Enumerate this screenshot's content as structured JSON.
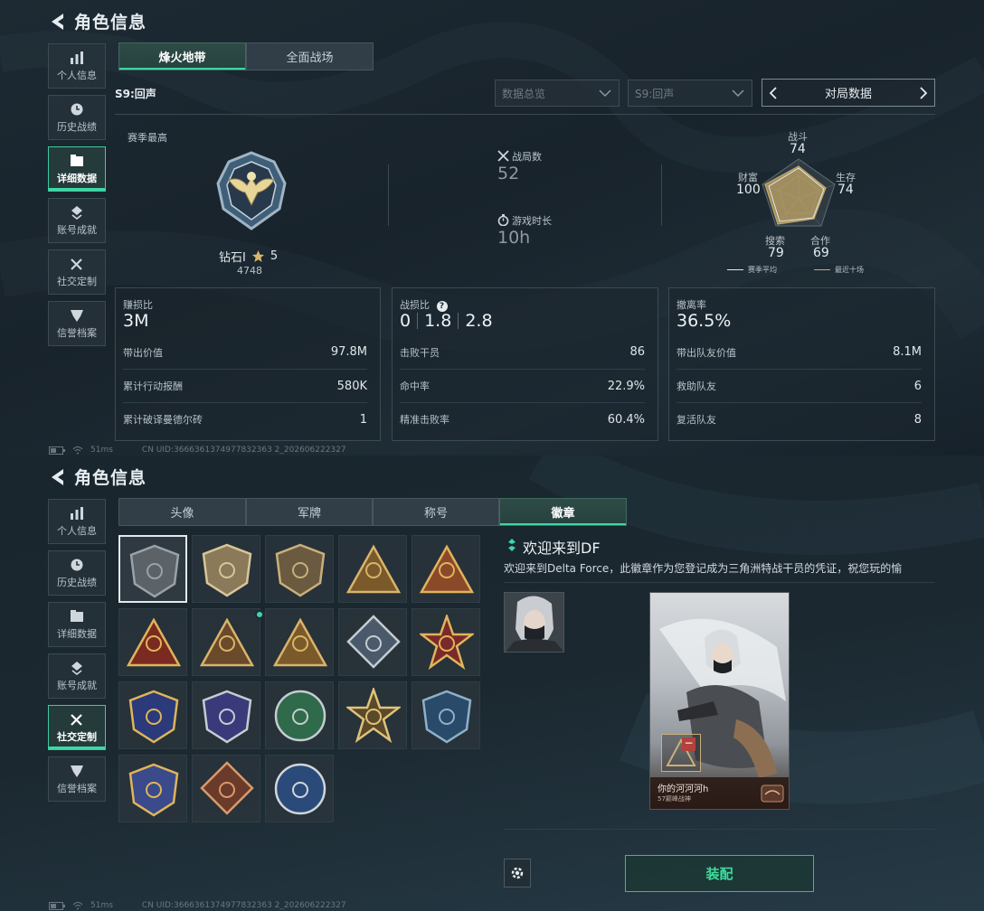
{
  "page_title": "角色信息",
  "sidebar": {
    "items": [
      {
        "label": "个人信息",
        "icon": "bar-chart-icon"
      },
      {
        "label": "历史战绩",
        "icon": "clock-icon"
      },
      {
        "label": "详细数据",
        "icon": "folder-icon"
      },
      {
        "label": "账号成就",
        "icon": "achievement-icon"
      },
      {
        "label": "社交定制",
        "icon": "tools-icon"
      },
      {
        "label": "信誉档案",
        "icon": "shield-icon"
      }
    ]
  },
  "screen1": {
    "tabs": [
      "烽火地带",
      "全面战场"
    ],
    "season": "S9:回声",
    "filter1": "数据总览",
    "filter2": "S9:回声",
    "pager_label": "对局数据",
    "season_best_label": "赛季最高",
    "rank_name": "钻石I",
    "rank_stars": "5",
    "rank_points": "4748",
    "matches_label": "战局数",
    "matches_value": "52",
    "playtime_label": "游戏时长",
    "playtime_value": "10h",
    "radar": {
      "labels": {
        "top": "战斗",
        "top_val": "74",
        "left": "财富",
        "left_val": "100",
        "right": "生存",
        "right_val": "74",
        "bl": "搜索",
        "bl_val": "79",
        "br": "合作",
        "br_val": "69"
      },
      "legend_avg": "赛季平均",
      "legend_recent": "最近十场",
      "colors": {
        "avg": "#e6e6e6",
        "recent": "#c7aa6a"
      }
    },
    "cards": [
      {
        "title": "赚损比",
        "value": "3M",
        "rows": [
          {
            "label": "带出价值",
            "value": "97.8M"
          },
          {
            "label": "累计行动报酬",
            "value": "580K"
          },
          {
            "label": "累计破译曼德尔砖",
            "value": "1"
          }
        ]
      },
      {
        "title": "战损比",
        "help": "?",
        "values": [
          "0",
          "1.8",
          "2.8"
        ],
        "rows": [
          {
            "label": "击败干员",
            "value": "86"
          },
          {
            "label": "命中率",
            "value": "22.9%"
          },
          {
            "label": "精准击败率",
            "value": "60.4%"
          }
        ]
      },
      {
        "title": "撤离率",
        "value": "36.5%",
        "rows": [
          {
            "label": "带出队友价值",
            "value": "8.1M"
          },
          {
            "label": "救助队友",
            "value": "6"
          },
          {
            "label": "复活队友",
            "value": "8"
          }
        ]
      }
    ]
  },
  "status": {
    "ping": "51ms",
    "uid": "CN UID:3666361374977832363 2_202606222327"
  },
  "screen2": {
    "tabs": [
      "头像",
      "军牌",
      "称号",
      "徽章"
    ],
    "detail_title": "欢迎来到DF",
    "detail_desc": "欢迎来到Delta Force，此徽章作为您登记成为三角洲特战干员的凭证，祝您玩的愉",
    "poster_name": "你的河河河h",
    "poster_sub": "57巅峰战神",
    "equip_label": "装配",
    "badges": [
      "triangle-emblem",
      "helicopter-emblem",
      "dagger-emblem",
      "fifty-seven-emblem",
      "ship-emblem",
      "number-one-emblem",
      "hex-star-emblem",
      "soldiers-emblem",
      "rose-diamond-emblem",
      "star-wheel-emblem",
      "gold-shield-emblem",
      "blue-shield-emblem",
      "green-skull-emblem",
      "gold-star-emblem",
      "rifle-shield-emblem",
      "swords-shield-emblem",
      "dragon-emblem",
      "wolf-emblem"
    ],
    "colors": {
      "accent": "#3fd6a5"
    }
  }
}
